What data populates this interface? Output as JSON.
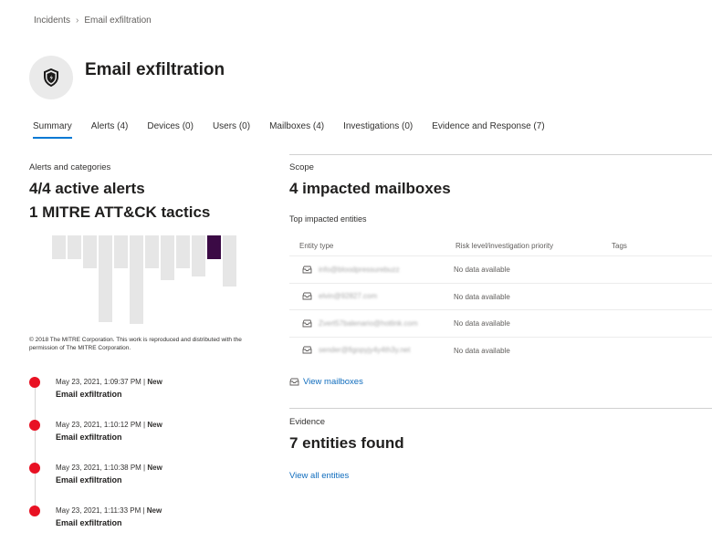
{
  "breadcrumb": {
    "items": [
      "Incidents",
      "Email exfiltration"
    ]
  },
  "header": {
    "title": "Email exfiltration",
    "icon": "shield-icon"
  },
  "tabs": [
    "Summary",
    "Alerts (4)",
    "Devices (0)",
    "Users (0)",
    "Mailboxes (4)",
    "Investigations (0)",
    "Evidence and Response (7)"
  ],
  "alerts": {
    "section_label": "Alerts and categories",
    "active_alerts": "4/4 active alerts",
    "tactics": "1 MITRE ATT&CK tactics",
    "mitre_copyright": "© 2018 The MITRE Corporation. This work is reproduced and distributed with the permission of The MITRE Corporation.",
    "timeline": [
      {
        "time": "May 23, 2021, 1:09:37 PM | ",
        "status": "New",
        "name": "Email exfiltration"
      },
      {
        "time": "May 23, 2021, 1:10:12 PM | ",
        "status": "New",
        "name": "Email exfiltration"
      },
      {
        "time": "May 23, 2021, 1:10:38 PM | ",
        "status": "New",
        "name": "Email exfiltration"
      },
      {
        "time": "May 23, 2021, 1:11:33 PM | ",
        "status": "New",
        "name": "Email exfiltration"
      }
    ]
  },
  "scope": {
    "section_label": "Scope",
    "headline": "4 impacted mailboxes",
    "sub_label": "Top impacted entities",
    "columns": [
      "Entity type",
      "Risk level/investigation priority",
      "Tags"
    ],
    "rows": [
      {
        "entity": "info@bloodpressurebuzz",
        "risk": "No data available"
      },
      {
        "entity": "elvin@92827.com",
        "risk": "No data available"
      },
      {
        "entity": "Zvert57balenario@hotlink.com",
        "risk": "No data available"
      },
      {
        "entity": "sender@figopyjy4y4th3y.net",
        "risk": "No data available"
      }
    ],
    "view_link": "View mailboxes"
  },
  "evidence": {
    "section_label": "Evidence",
    "headline": "7 entities found",
    "view_link": "View all entities"
  },
  "colors": {
    "accent": "#0078d4",
    "alert_dot": "#e81123",
    "tactic_highlight": "#3b0a45"
  }
}
